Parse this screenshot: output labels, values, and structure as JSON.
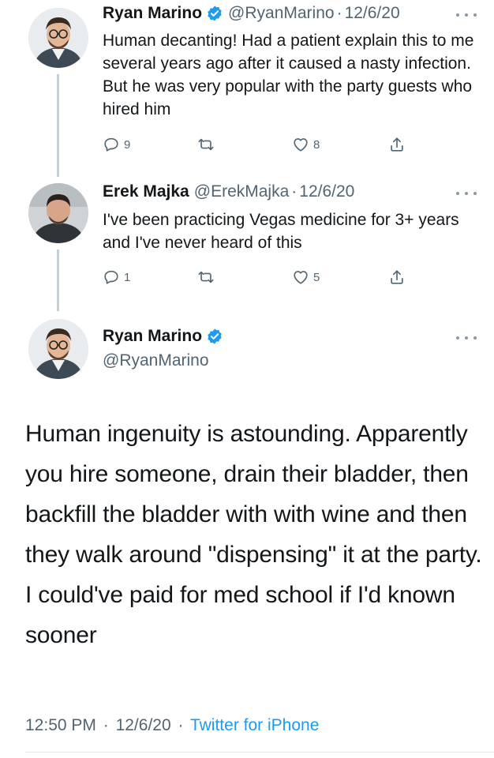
{
  "tweets": [
    {
      "name": "Ryan Marino",
      "verified": true,
      "handle": "@RyanMarino",
      "separator": "·",
      "date": "12/6/20",
      "text": "Human decanting! Had a patient explain this to me several years ago after it caused a nasty infection. But he was very popular with the party guests who hired him",
      "replies": "9",
      "retweets": "",
      "likes": "8"
    },
    {
      "name": "Erek Majka",
      "verified": false,
      "handle": "@ErekMajka",
      "separator": "·",
      "date": "12/6/20",
      "text": "I've been practicing Vegas medicine for 3+ years and I've never heard of this",
      "replies": "1",
      "retweets": "",
      "likes": "5"
    }
  ],
  "main_tweet": {
    "name": "Ryan Marino",
    "verified": true,
    "handle": "@RyanMarino",
    "text": "Human ingenuity is astounding. Apparently you hire someone, drain their bladder, then backfill the bladder with with wine and then they walk around \"dispensing\" it at the party. I could've paid for med school if I'd known sooner",
    "time": "12:50 PM",
    "separator": "·",
    "date": "12/6/20",
    "source": "Twitter for iPhone"
  },
  "icons": {
    "reply": "reply-icon",
    "retweet": "retweet-icon",
    "like": "heart-icon",
    "share": "share-icon",
    "verified": "verified-badge-icon",
    "more": "more-options-icon"
  },
  "colors": {
    "accent": "#1d9bf0",
    "secondary_text": "#536471",
    "primary_text": "#14171a",
    "thread_line": "#c4cfd6"
  }
}
